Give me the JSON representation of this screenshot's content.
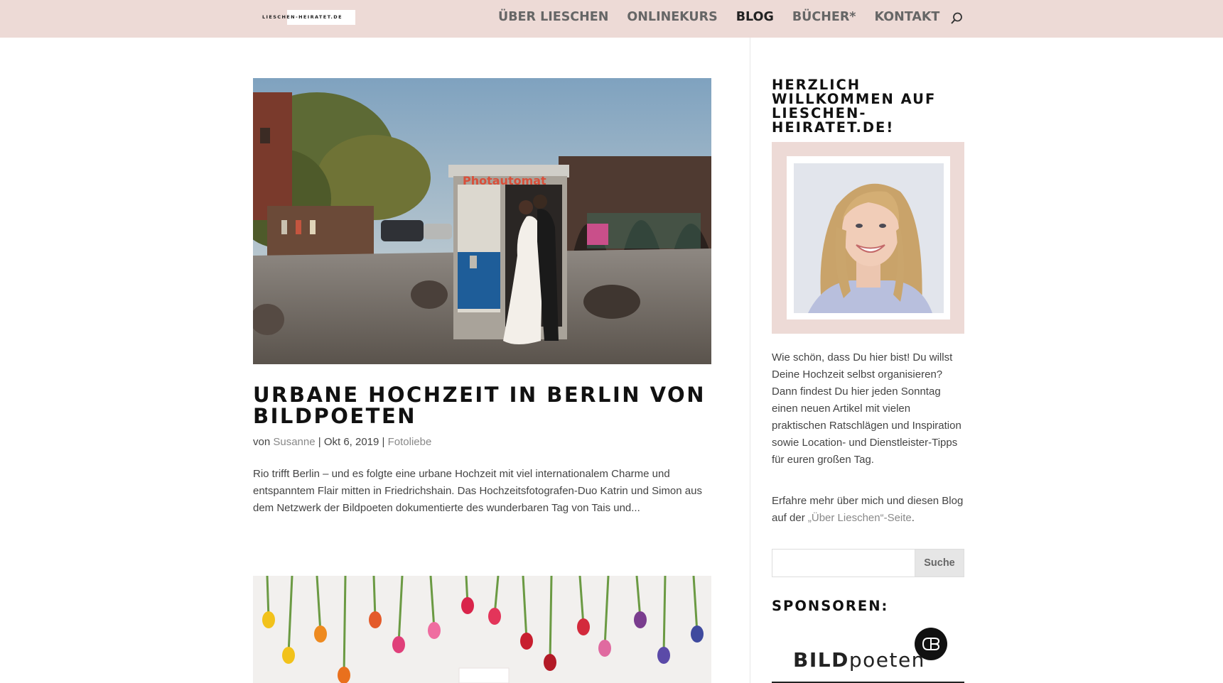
{
  "header": {
    "logo_text": "LIESCHEN-HEIRATET.DE",
    "nav": [
      {
        "label": "ÜBER LIESCHEN",
        "active": false
      },
      {
        "label": "ONLINEKURS",
        "active": false
      },
      {
        "label": "BLOG",
        "active": true
      },
      {
        "label": "BÜCHER*",
        "active": false
      },
      {
        "label": "KONTAKT",
        "active": false
      }
    ]
  },
  "post": {
    "title": "URBANE HOCHZEIT IN BERLIN VON BILDPOETEN",
    "meta_prefix": "von ",
    "author": "Susanne",
    "sep1": " | ",
    "date": "Okt 6, 2019",
    "sep2": " | ",
    "category": "Fotoliebe",
    "excerpt": "Rio trifft Berlin – und es folgte eine urbane Hochzeit mit viel internationalem Charme und entspanntem Flair mitten in Friedrichshain. Das Hochzeitsfotografen-Duo Katrin und Simon  aus dem Netzwerk der Bildpoeten dokumentierte des wunderbaren Tag von Tais und..."
  },
  "sidebar": {
    "welcome_title": "HERZLICH WILLKOMMEN AUF LIESCHEN-HEIRATET.DE!",
    "intro": "Wie schön, dass Du hier bist! Du willst Deine Hochzeit selbst organisieren? Dann findest Du hier jeden Sonntag einen neuen Artikel mit vielen praktischen Ratschlägen und Inspiration sowie Location- und Dienstleister-Tipps für euren großen Tag.",
    "more_prefix": "Erfahre mehr über mich und diesen Blog auf der ",
    "more_link": "„Über Lieschen“-Seite",
    "more_suffix": ".",
    "search_placeholder": "",
    "search_button": "Suche",
    "sponsors_title": "SPONSOREN:",
    "sponsor_bold": "BILD",
    "sponsor_rest": "poeten"
  },
  "colors": {
    "header_bg": "#eddad6",
    "text": "#444444",
    "link": "#888888",
    "heading": "#111111"
  }
}
